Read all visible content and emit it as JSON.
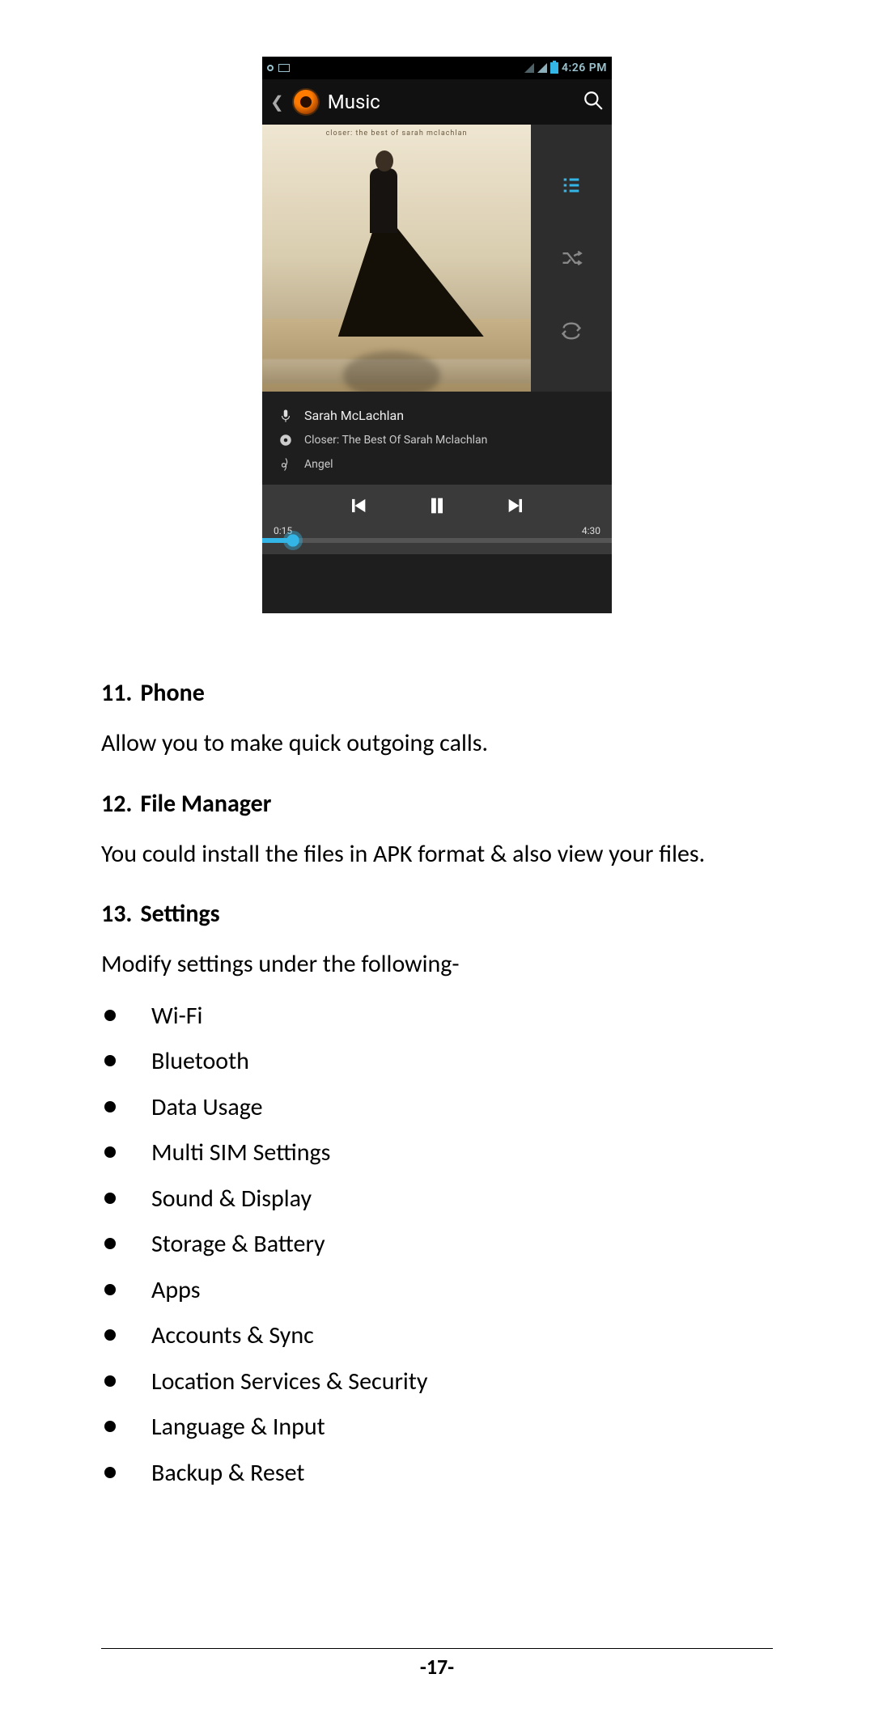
{
  "screenshot": {
    "status": {
      "time": "4:26 PM"
    },
    "appbar": {
      "title": "Music"
    },
    "album_caption": "closer: the best of sarah mclachlan",
    "meta": {
      "artist": "Sarah McLachlan",
      "album": "Closer: The Best Of Sarah Mclachlan",
      "track": "Angel"
    },
    "time": {
      "elapsed": "0:15",
      "total": "4:30"
    }
  },
  "sections": [
    {
      "num": "11.",
      "title": "Phone",
      "body": "Allow you to make quick outgoing calls."
    },
    {
      "num": "12.",
      "title": "File Manager",
      "body": "You could install the files in APK format & also view your files."
    },
    {
      "num": "13.",
      "title": "Settings",
      "body": "Modify settings under the following-"
    }
  ],
  "settings_items": [
    "Wi-Fi",
    "Bluetooth",
    "Data Usage",
    "Multi SIM Settings",
    "Sound & Display",
    "Storage & Battery",
    "Apps",
    "Accounts & Sync",
    "Location Services & Security",
    "Language & Input",
    "Backup & Reset"
  ],
  "page_number": "-17-"
}
